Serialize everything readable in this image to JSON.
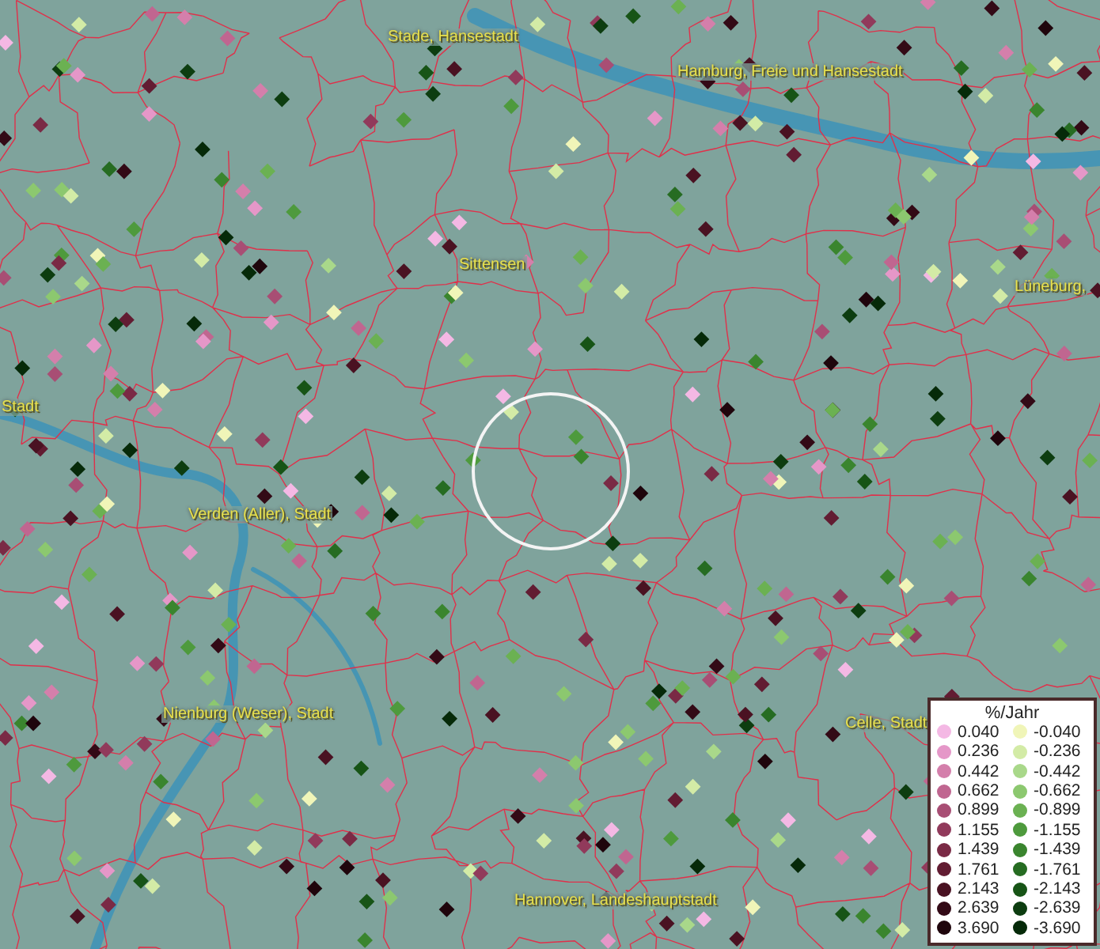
{
  "map": {
    "places": [
      {
        "name": "Stade, Hansestadt"
      },
      {
        "name": "Hamburg, Freie und Hansestadt"
      },
      {
        "name": "Sittensen"
      },
      {
        "name": "Lüneburg,"
      },
      {
        "name": "Stadt"
      },
      {
        "name": "Verden (Aller), Stadt"
      },
      {
        "name": "Nienburg (Weser), Stadt"
      },
      {
        "name": "Celle, Stadt"
      },
      {
        "name": "Hannover, Landeshauptstadt"
      }
    ]
  },
  "legend": {
    "title": "%/Jahr",
    "rows": [
      {
        "positive": {
          "value": "0.040",
          "color": "#f4b8e4"
        },
        "negative": {
          "value": "-0.040",
          "color": "#f0f5b8"
        }
      },
      {
        "positive": {
          "value": "0.236",
          "color": "#e597c8"
        },
        "negative": {
          "value": "-0.236",
          "color": "#d3eba6"
        }
      },
      {
        "positive": {
          "value": "0.442",
          "color": "#d47fab"
        },
        "negative": {
          "value": "-0.442",
          "color": "#a9d88a"
        }
      },
      {
        "positive": {
          "value": "0.662",
          "color": "#c06690"
        },
        "negative": {
          "value": "-0.662",
          "color": "#8cc86f"
        }
      },
      {
        "positive": {
          "value": "0.899",
          "color": "#a84e74"
        },
        "negative": {
          "value": "-0.899",
          "color": "#6bb152"
        }
      },
      {
        "positive": {
          "value": "1.155",
          "color": "#913a5b"
        },
        "negative": {
          "value": "-1.155",
          "color": "#4e9a3d"
        }
      },
      {
        "positive": {
          "value": "1.439",
          "color": "#7a2a45"
        },
        "negative": {
          "value": "-1.439",
          "color": "#3a852e"
        }
      },
      {
        "positive": {
          "value": "1.761",
          "color": "#621c32"
        },
        "negative": {
          "value": "-1.761",
          "color": "#266c22"
        }
      },
      {
        "positive": {
          "value": "2.143",
          "color": "#4a1222"
        },
        "negative": {
          "value": "-2.143",
          "color": "#175416"
        }
      },
      {
        "positive": {
          "value": "2.639",
          "color": "#330a16"
        },
        "negative": {
          "value": "-2.639",
          "color": "#0d3d10"
        }
      },
      {
        "positive": {
          "value": "3.690",
          "color": "#1f050c"
        },
        "negative": {
          "value": "-3.690",
          "color": "#062a09"
        }
      }
    ]
  }
}
